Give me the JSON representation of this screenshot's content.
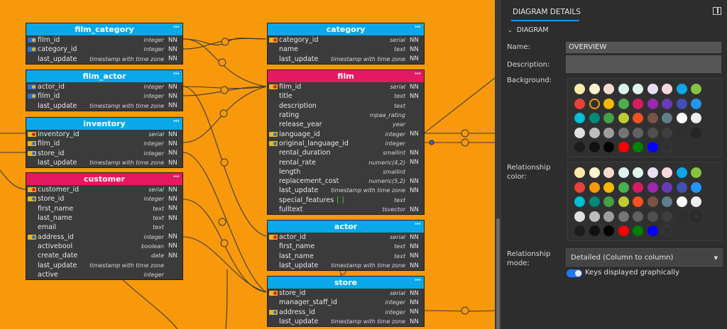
{
  "tables": [
    {
      "id": "film_category",
      "title": "film_category",
      "color": "#0aa8e8",
      "rows": [
        {
          "key": "pf",
          "name": "film_id",
          "type": "integer",
          "nn": "NN"
        },
        {
          "key": "pf",
          "name": "category_id",
          "type": "integer",
          "nn": "NN"
        },
        {
          "key": "",
          "name": "last_update",
          "type": "timestamp with time zone",
          "nn": "NN"
        }
      ]
    },
    {
      "id": "film_actor",
      "title": "film_actor",
      "color": "#0aa8e8",
      "rows": [
        {
          "key": "pf",
          "name": "actor_id",
          "type": "integer",
          "nn": "NN"
        },
        {
          "key": "pf",
          "name": "film_id",
          "type": "integer",
          "nn": "NN"
        },
        {
          "key": "",
          "name": "last_update",
          "type": "timestamp with time zone",
          "nn": "NN"
        }
      ]
    },
    {
      "id": "inventory",
      "title": "inventory",
      "color": "#0aa8e8",
      "rows": [
        {
          "key": "pk",
          "name": "inventory_id",
          "type": "serial",
          "nn": "NN"
        },
        {
          "key": "fk",
          "name": "film_id",
          "type": "integer",
          "nn": "NN"
        },
        {
          "key": "fk",
          "name": "store_id",
          "type": "integer",
          "nn": "NN"
        },
        {
          "key": "",
          "name": "last_update",
          "type": "timestamp with time zone",
          "nn": "NN"
        }
      ]
    },
    {
      "id": "customer",
      "title": "customer",
      "color": "#e5195f",
      "rows": [
        {
          "key": "pk",
          "name": "customer_id",
          "type": "serial",
          "nn": "NN"
        },
        {
          "key": "fk",
          "name": "store_id",
          "type": "integer",
          "nn": "NN"
        },
        {
          "key": "",
          "name": "first_name",
          "type": "text",
          "nn": "NN"
        },
        {
          "key": "",
          "name": "last_name",
          "type": "text",
          "nn": "NN"
        },
        {
          "key": "",
          "name": "email",
          "type": "text",
          "nn": ""
        },
        {
          "key": "fk",
          "name": "address_id",
          "type": "integer",
          "nn": "NN"
        },
        {
          "key": "",
          "name": "activebool",
          "type": "boolean",
          "nn": "NN"
        },
        {
          "key": "",
          "name": "create_date",
          "type": "date",
          "nn": "NN"
        },
        {
          "key": "",
          "name": "last_update",
          "type": "timestamp with time zone",
          "nn": ""
        },
        {
          "key": "",
          "name": "active",
          "type": "integer",
          "nn": ""
        }
      ]
    },
    {
      "id": "category",
      "title": "category",
      "color": "#0aa8e8",
      "rows": [
        {
          "key": "pk",
          "name": "category_id",
          "type": "serial",
          "nn": "NN"
        },
        {
          "key": "",
          "name": "name",
          "type": "text",
          "nn": "NN"
        },
        {
          "key": "",
          "name": "last_update",
          "type": "timestamp with time zone",
          "nn": "NN"
        }
      ]
    },
    {
      "id": "film",
      "title": "film",
      "color": "#e5195f",
      "rows": [
        {
          "key": "pk",
          "name": "film_id",
          "type": "serial",
          "nn": "NN"
        },
        {
          "key": "",
          "name": "title",
          "type": "text",
          "nn": "NN"
        },
        {
          "key": "",
          "name": "description",
          "type": "text",
          "nn": ""
        },
        {
          "key": "",
          "name": "rating",
          "type": "mpaa_rating",
          "nn": ""
        },
        {
          "key": "",
          "name": "release_year",
          "type": "year",
          "nn": ""
        },
        {
          "key": "fk",
          "name": "language_id",
          "type": "integer",
          "nn": "NN"
        },
        {
          "key": "fk",
          "name": "original_language_id",
          "type": "integer",
          "nn": ""
        },
        {
          "key": "",
          "name": "rental_duration",
          "type": "smallint",
          "nn": "NN"
        },
        {
          "key": "",
          "name": "rental_rate",
          "type": "numeric(4,2)",
          "nn": "NN"
        },
        {
          "key": "",
          "name": "length",
          "type": "smallint",
          "nn": ""
        },
        {
          "key": "",
          "name": "replacement_cost",
          "type": "numeric(5,2)",
          "nn": "NN"
        },
        {
          "key": "",
          "name": "last_update",
          "type": "timestamp with time zone",
          "nn": "NN"
        },
        {
          "key": "",
          "name": "special_features",
          "bracket": "[ ]",
          "type": "text",
          "nn": ""
        },
        {
          "key": "",
          "name": "fulltext",
          "type": "tsvector",
          "nn": "NN"
        }
      ]
    },
    {
      "id": "actor",
      "title": "actor",
      "color": "#0aa8e8",
      "rows": [
        {
          "key": "pk",
          "name": "actor_id",
          "type": "serial",
          "nn": "NN"
        },
        {
          "key": "",
          "name": "first_name",
          "type": "text",
          "nn": "NN"
        },
        {
          "key": "",
          "name": "last_name",
          "type": "text",
          "nn": "NN"
        },
        {
          "key": "",
          "name": "last_update",
          "type": "timestamp with time zone",
          "nn": "NN"
        }
      ]
    },
    {
      "id": "store",
      "title": "store",
      "color": "#0aa8e8",
      "rows": [
        {
          "key": "pk",
          "name": "store_id",
          "type": "serial",
          "nn": "NN"
        },
        {
          "key": "",
          "name": "manager_staff_id",
          "type": "integer",
          "nn": "NN"
        },
        {
          "key": "fk",
          "name": "address_id",
          "type": "integer",
          "nn": "NN"
        },
        {
          "key": "",
          "name": "last_update",
          "type": "timestamp with time zone",
          "nn": "NN"
        }
      ]
    }
  ],
  "table_menu_glyph": "···",
  "panel": {
    "title": "DIAGRAM DETAILS",
    "section": "DIAGRAM",
    "name_label": "Name:",
    "name_value": "OVERVIEW",
    "description_label": "Description:",
    "description_value": "",
    "background_label": "Background:",
    "relationship_color_label": "Relationship color:",
    "relationship_mode_label": "Relationship mode:",
    "relationship_mode_value": "Detailed (Column to column)",
    "keys_toggle_label": "Keys displayed graphically"
  },
  "colors": {
    "canvas": "#f7990a",
    "table_body": "#3b3b3b",
    "accent": "#1e90ff",
    "palette": [
      [
        "#fde9a9",
        "#fdf2cd",
        "#f9dcd0",
        "#d9f2ee",
        "#dff4ea",
        "#e8def4",
        "#f6d7dd",
        "#0aa8e8",
        "#86c340"
      ],
      [
        "#e8413a",
        "#f7990a",
        "#f5b900",
        "#4caf50",
        "#d81b60",
        "#9c27b0",
        "#673ab7",
        "#3f51b5",
        "#2196f3"
      ],
      [
        "#00bcd4",
        "#00897b",
        "#43a047",
        "#c0ca33",
        "#f4511e",
        "#795548",
        "#607d8b",
        "#ffffff",
        "#eeeeee"
      ],
      [
        "#e0e0e0",
        "#bdbdbd",
        "#9e9e9e",
        "#757575",
        "#616161",
        "#4f4f4f",
        "#3e3e3e",
        "#2e2e2e",
        "#262626"
      ],
      [
        "#1c1c1c",
        "#111111",
        "#000000",
        "#ff0000",
        "#008000",
        "#0000ff",
        "#333333"
      ]
    ]
  }
}
